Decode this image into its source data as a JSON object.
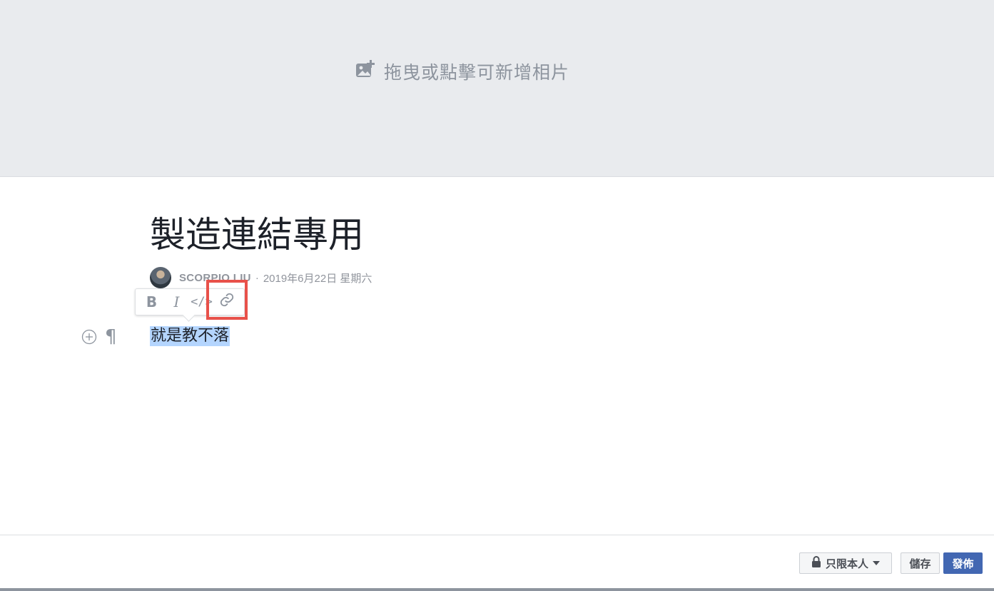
{
  "cover": {
    "hint": "拖曳或點擊可新增相片",
    "icon": "add-photo-icon"
  },
  "note": {
    "title": "製造連結專用",
    "author": "SCORPIO LIU",
    "separator": "·",
    "date": "2019年6月22日 星期六",
    "body": "就是教不落"
  },
  "toolbar": {
    "bold": "B",
    "italic": "I",
    "code": "</>",
    "link_icon": "link-icon"
  },
  "editor": {
    "pilcrow": "¶",
    "add_icon": "plus-circle-icon"
  },
  "footer": {
    "privacy_label": "只限本人",
    "save_label": "儲存",
    "publish_label": "發佈"
  },
  "colors": {
    "cover_bg": "#e9ebee",
    "highlight_box": "#e8514a",
    "selection": "#b4d5fe",
    "publish_bg": "#4267b2"
  }
}
